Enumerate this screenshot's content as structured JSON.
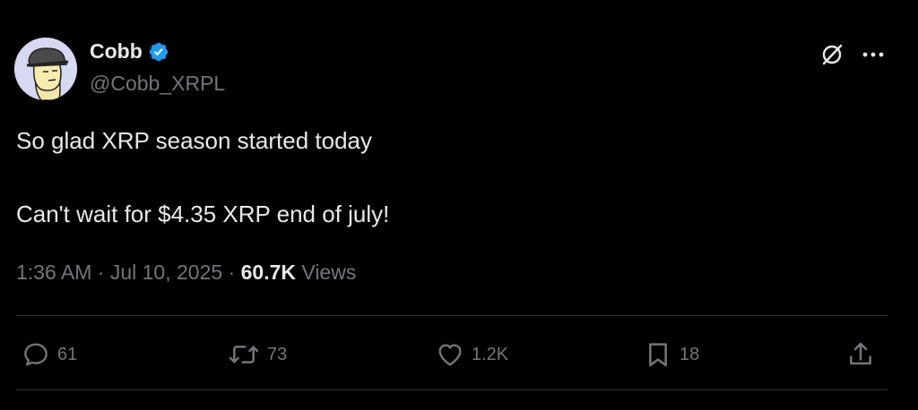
{
  "tweet": {
    "author_name": "Cobb",
    "author_handle": "@Cobb_XRPL",
    "text_line1": "So glad XRP season started today",
    "text_line2": "Can't wait for $4.35 XRP end of july!",
    "time": "1:36 AM",
    "separator": "·",
    "date": "Jul 10, 2025",
    "views_count": "60.7K",
    "views_label": "Views"
  },
  "actions": {
    "replies": "61",
    "retweets": "73",
    "likes": "1.2K",
    "bookmarks": "18"
  },
  "icons": {
    "verified": "verified-badge-icon",
    "grok": "grok-icon",
    "more": "more-icon",
    "reply": "reply-icon",
    "retweet": "retweet-icon",
    "like": "heart-icon",
    "bookmark": "bookmark-icon",
    "share": "share-icon"
  },
  "colors": {
    "background": "#000000",
    "primary_text": "#e7e9ea",
    "secondary_text": "#71767b",
    "verified_blue": "#1d9bf0",
    "divider": "#2f3336"
  }
}
